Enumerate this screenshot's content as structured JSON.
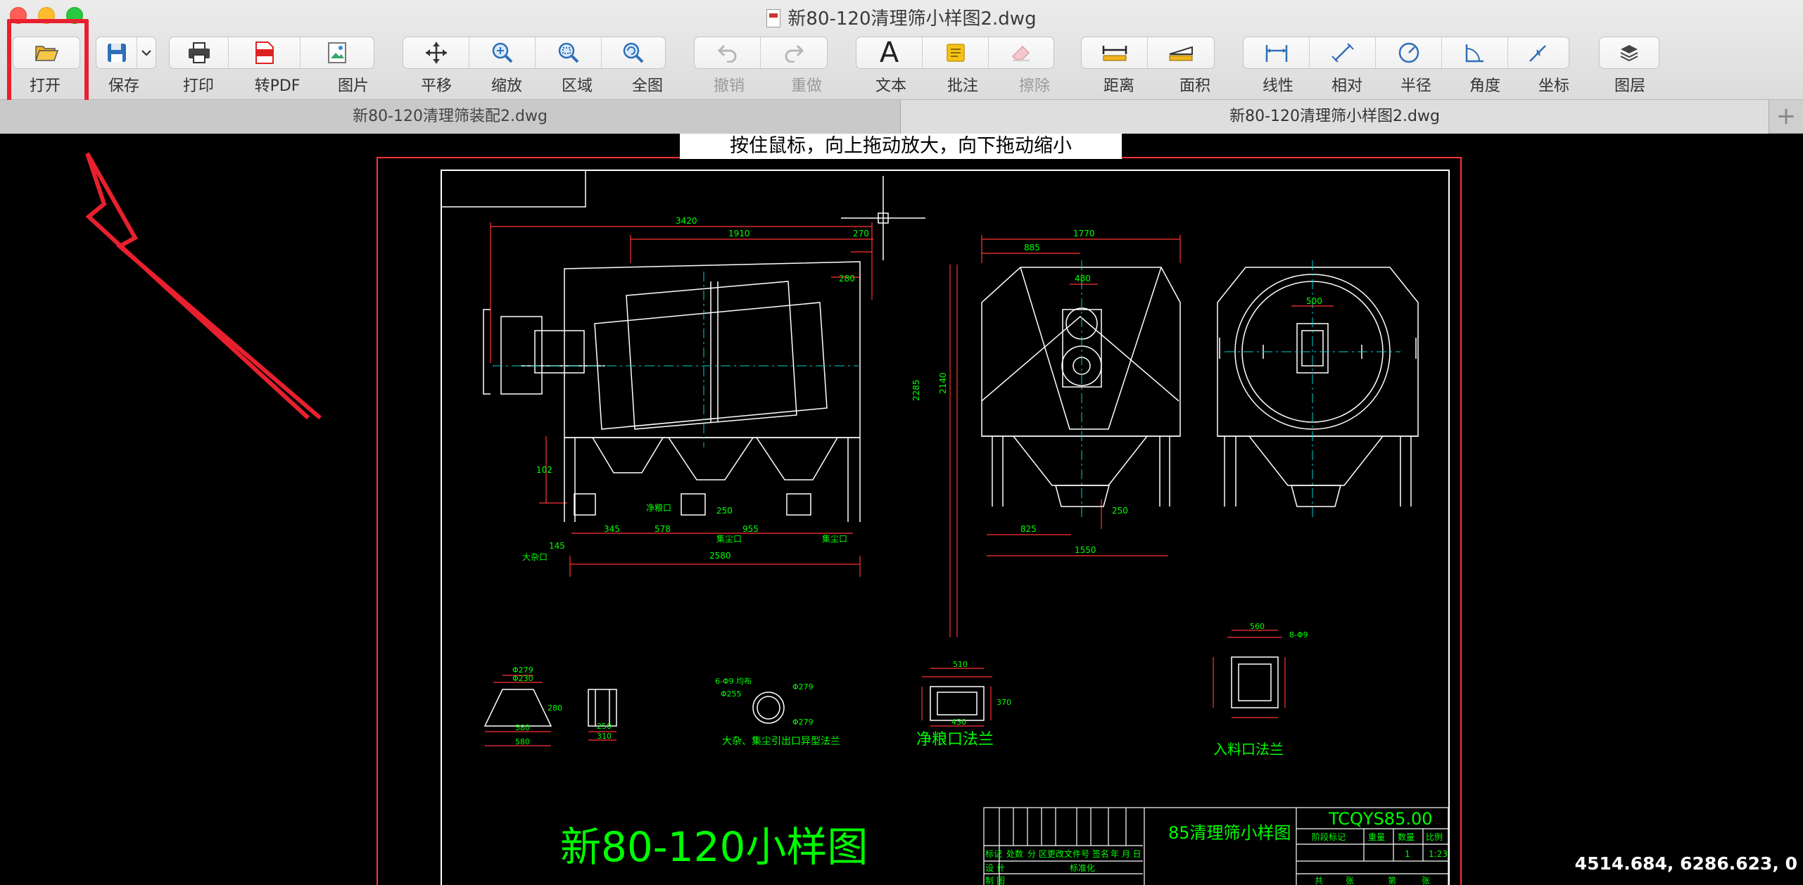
{
  "window": {
    "title": "新80-120清理筛小样图2.dwg"
  },
  "toolbar": {
    "open": "打开",
    "save": "保存",
    "print": "打印",
    "to_pdf": "转PDF",
    "image": "图片",
    "pan": "平移",
    "zoom": "缩放",
    "region": "区域",
    "full": "全图",
    "undo": "撤销",
    "redo": "重做",
    "text": "文本",
    "annotate": "批注",
    "erase": "擦除",
    "distance": "距离",
    "area": "面积",
    "linear": "线性",
    "relative": "相对",
    "radius": "半径",
    "angle": "角度",
    "coordinate": "坐标",
    "layers": "图层",
    "text_icon_glyph": "A"
  },
  "tabs": [
    "新80-120清理筛装配2.dwg",
    "新80-120清理筛小样图2.dwg"
  ],
  "tab_add": "+",
  "hint": "按住鼠标，向上拖动放大，向下拖动缩小",
  "coords": "4514.684, 6286.623, 0",
  "drawing": {
    "big_title": "新80-120小样图",
    "title_block_name": "85清理筛小样图",
    "code": "TCQYS85.00",
    "label_clean_flange": "净粮口法兰",
    "label_inlet_flange": "入料口法兰",
    "label_bottom_flange": "大杂、集尘引出口异型法兰",
    "label_clean_port": "净粮口",
    "label_dust_port": "集尘口",
    "label_big_port": "大杂口",
    "label_dust_port2": "集尘口",
    "dim_3420": "3420",
    "dim_1910": "1910",
    "dim_270": "270",
    "dim_280": "280",
    "dim_345": "345",
    "dim_578": "578",
    "dim_955": "955",
    "dim_2580": "2580",
    "dim_1770": "1770",
    "dim_885": "885",
    "dim_480": "480",
    "dim_2285": "2285",
    "dim_2140": "2140",
    "dim_825": "825",
    "dim_1550": "1550",
    "dim_250": "250",
    "dim_500": "500",
    "dim_102": "102",
    "dim_145": "145",
    "dim_250b": "250",
    "tb_h1": "标记",
    "tb_h2": "处数",
    "tb_h3": "分 区",
    "tb_h4": "更改文件号",
    "tb_h5": "签名",
    "tb_h6": "年 月 日",
    "tb_design": "设 计",
    "tb_std": "标准化",
    "tb_draw": "制 图",
    "tb_stage": "阶段标记",
    "tb_weight": "重量",
    "tb_qty": "数量",
    "tb_scale": "比例",
    "tb_qty_v": "1",
    "tb_scale_v": "1:23",
    "tb_total": "共",
    "tb_sheet": "张",
    "tb_no": "第",
    "tb_sheet2": "张",
    "s_d279": "Φ279",
    "s_d230": "Φ230",
    "s_280": "280",
    "s_580a": "580",
    "s_580b": "580",
    "s_250": "250",
    "s_310": "310",
    "s_holes": "6-Φ9 均布",
    "s_d255": "Φ255",
    "s_d279b": "Φ279",
    "s_d279c": "Φ279",
    "s_510": "510",
    "s_450": "450",
    "s_370": "370",
    "s_560": "560",
    "s_8d9": "8-Φ9"
  },
  "colors": {
    "highlight": "#e8202e",
    "border": "#ff3333",
    "frame": "#ffffff",
    "dim": "#00ff00"
  }
}
